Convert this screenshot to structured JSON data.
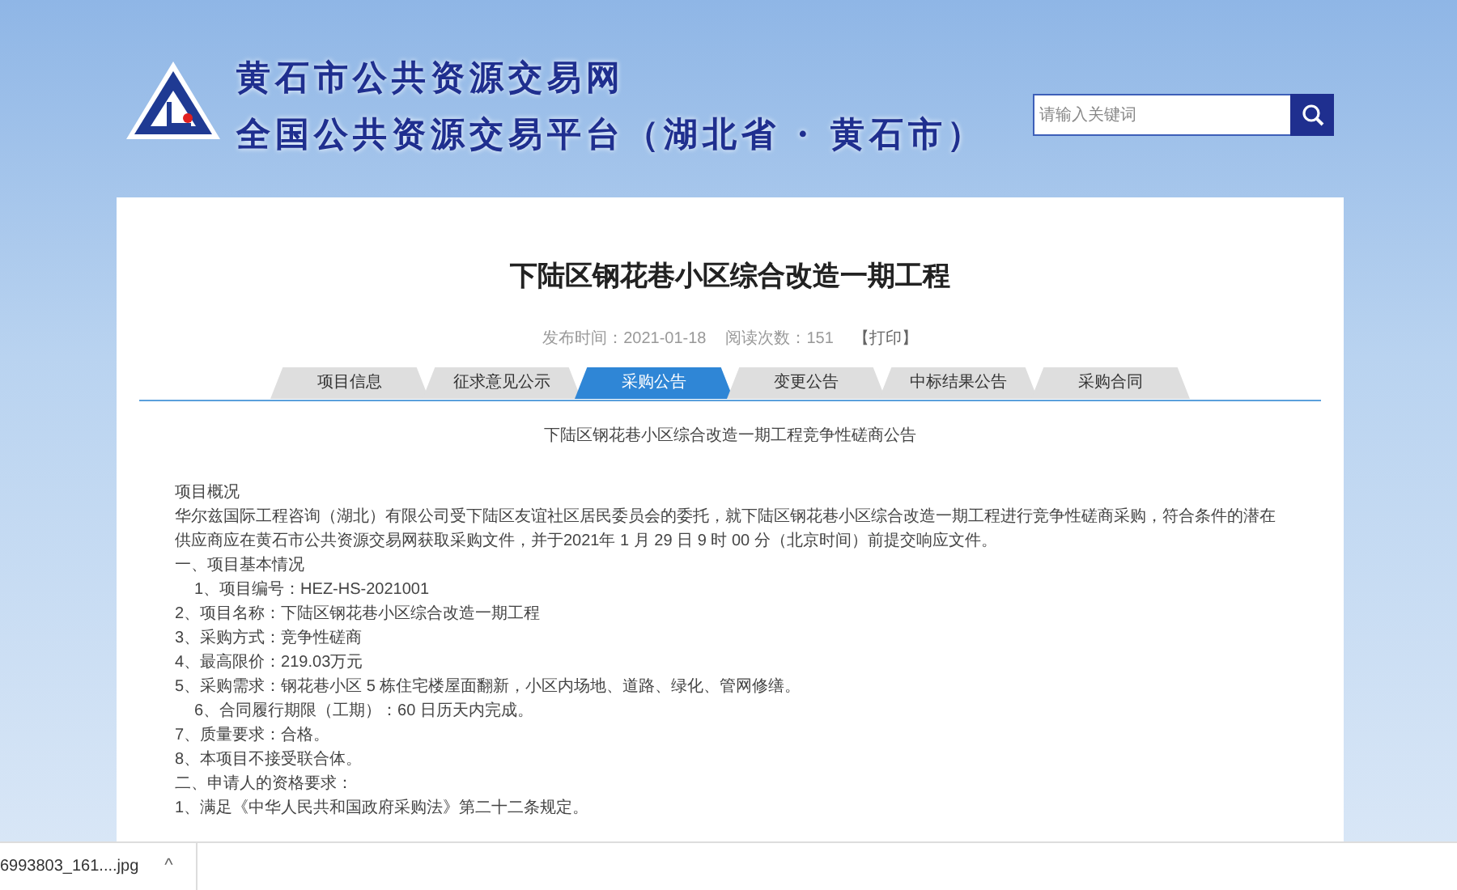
{
  "header": {
    "site_name": "黄石市公共资源交易网",
    "platform_name": "全国公共资源交易平台（湖北省 · 黄石市）",
    "search": {
      "placeholder": "请输入关键词"
    }
  },
  "article": {
    "title": "下陆区钢花巷小区综合改造一期工程",
    "meta": {
      "publish_time": "发布时间：2021-01-18",
      "views": "阅读次数：151",
      "print": "【打印】"
    },
    "tabs": [
      {
        "label": "项目信息",
        "selected": false
      },
      {
        "label": "征求意见公示",
        "selected": false
      },
      {
        "label": "采购公告",
        "selected": true
      },
      {
        "label": "变更公告",
        "selected": false
      },
      {
        "label": "中标结果公告",
        "selected": false
      },
      {
        "label": "采购合同",
        "selected": false
      }
    ],
    "notice_title": "下陆区钢花巷小区综合改造一期工程竞争性磋商公告",
    "paragraphs": [
      {
        "kind": "plain",
        "text": "项目概况"
      },
      {
        "kind": "plain",
        "text": "华尔兹国际工程咨询（湖北）有限公司受下陆区友谊社区居民委员会的委托，就下陆区钢花巷小区综合改造一期工程进行竞争性磋商采购，符合条件的潜在供应商应在黄石市公共资源交易网获取采购文件，并于2021年 1 月 29 日  9  时 00 分（北京时间）前提交响应文件。"
      },
      {
        "kind": "plain",
        "text": "一、项目基本情况"
      },
      {
        "kind": "indented",
        "text": "1、项目编号：HEZ-HS-2021001"
      },
      {
        "kind": "plain",
        "text": "2、项目名称：下陆区钢花巷小区综合改造一期工程"
      },
      {
        "kind": "plain",
        "text": "3、采购方式：竞争性磋商"
      },
      {
        "kind": "plain",
        "text": "4、最高限价：219.03万元"
      },
      {
        "kind": "plain",
        "text": "5、采购需求：钢花巷小区 5 栋住宅楼屋面翻新，小区内场地、道路、绿化、管网修缮。"
      },
      {
        "kind": "indented",
        "text": "6、合同履行期限（工期）：60 日历天内完成。"
      },
      {
        "kind": "plain",
        "text": "7、质量要求：合格。"
      },
      {
        "kind": "plain",
        "text": "8、本项目不接受联合体。"
      },
      {
        "kind": "plain",
        "text": "二、申请人的资格要求："
      },
      {
        "kind": "plain",
        "text": "1、满足《中华人民共和国政府采购法》第二十二条规定。"
      }
    ]
  },
  "download_bar": {
    "file_name": "6993803_161....jpg",
    "expand_icon": "^"
  }
}
